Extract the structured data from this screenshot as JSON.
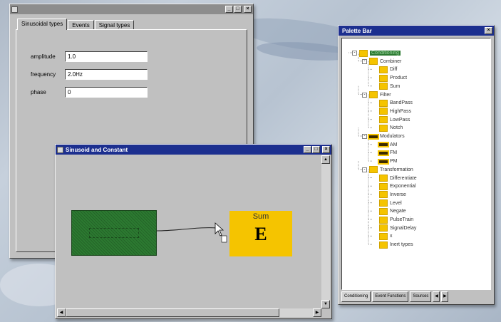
{
  "editor_window": {
    "title": "",
    "tabs": [
      "Sinusoidal types",
      "Events",
      "Signal types"
    ],
    "fields": [
      {
        "label": "amplitude",
        "value": "1.0"
      },
      {
        "label": "frequency",
        "value": "2.0Hz"
      },
      {
        "label": "phase",
        "value": "0"
      }
    ]
  },
  "diagram_window": {
    "title": "Sinusoid and Constant",
    "sum_block": {
      "label": "Sum",
      "glyph": "E"
    }
  },
  "palette_window": {
    "title": "Palette Bar",
    "tree": [
      {
        "label": "Conditioning",
        "level": 0,
        "expander": "-",
        "highlight": true
      },
      {
        "label": "Combiner",
        "level": 1,
        "expander": "-"
      },
      {
        "label": "Diff",
        "level": 2
      },
      {
        "label": "Product",
        "level": 2
      },
      {
        "label": "Sum",
        "level": 2
      },
      {
        "label": "Filter",
        "level": 1,
        "expander": "-"
      },
      {
        "label": "BandPass",
        "level": 2
      },
      {
        "label": "HighPass",
        "level": 2
      },
      {
        "label": "LowPass",
        "level": 2
      },
      {
        "label": "Notch",
        "level": 2
      },
      {
        "label": "Modulators",
        "level": 1,
        "expander": "-",
        "icon": "modulator"
      },
      {
        "label": "AM",
        "level": 2,
        "icon": "modulator"
      },
      {
        "label": "FM",
        "level": 2,
        "icon": "modulator"
      },
      {
        "label": "PM",
        "level": 2,
        "icon": "modulator"
      },
      {
        "label": "Transformation",
        "level": 1,
        "expander": "-"
      },
      {
        "label": "Differentiate",
        "level": 2
      },
      {
        "label": "Exponential",
        "level": 2
      },
      {
        "label": "Inverse",
        "level": 2
      },
      {
        "label": "Level",
        "level": 2
      },
      {
        "label": "Negate",
        "level": 2
      },
      {
        "label": "PulseTrain",
        "level": 2
      },
      {
        "label": "SignalDelay",
        "level": 2
      },
      {
        "label": "x",
        "level": 2
      },
      {
        "label": "Inert types",
        "level": 2
      }
    ],
    "bottom_tabs": [
      "Conditioning",
      "Event Functions",
      "Sources"
    ]
  }
}
